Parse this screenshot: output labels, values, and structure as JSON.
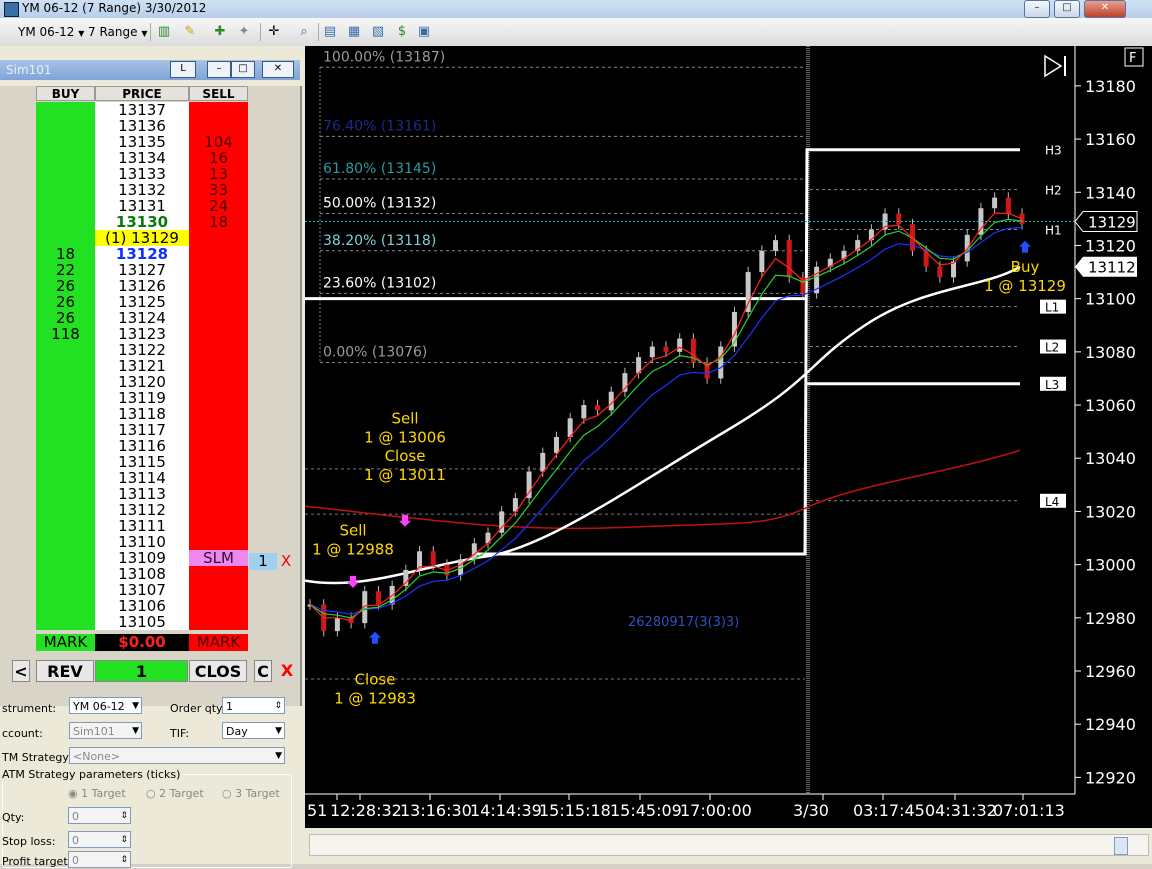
{
  "window": {
    "title": "YM 06-12 (7 Range)  3/30/2012",
    "min": "–",
    "max": "□",
    "close": "✕"
  },
  "toolbar": {
    "instrument": "YM 06-12",
    "period": "7 Range"
  },
  "dom": {
    "account": "Sim101",
    "btn_l": "L",
    "headers": {
      "buy": "BUY",
      "price": "PRICE",
      "sell": "SELL"
    },
    "rows": [
      {
        "price": "13137",
        "buy": "",
        "sell": ""
      },
      {
        "price": "13136",
        "buy": "",
        "sell": ""
      },
      {
        "price": "13135",
        "buy": "",
        "sell": "104"
      },
      {
        "price": "13134",
        "buy": "",
        "sell": "16"
      },
      {
        "price": "13133",
        "buy": "",
        "sell": "13"
      },
      {
        "price": "13132",
        "buy": "",
        "sell": "33"
      },
      {
        "price": "13131",
        "buy": "",
        "sell": "24"
      },
      {
        "price": "13130",
        "buy": "",
        "sell": "18"
      },
      {
        "price": "(1) 13129",
        "buy": "",
        "sell": ""
      },
      {
        "price": "13128",
        "buy": "18",
        "sell": ""
      },
      {
        "price": "13127",
        "buy": "22",
        "sell": ""
      },
      {
        "price": "13126",
        "buy": "26",
        "sell": ""
      },
      {
        "price": "13125",
        "buy": "26",
        "sell": ""
      },
      {
        "price": "13124",
        "buy": "26",
        "sell": ""
      },
      {
        "price": "13123",
        "buy": "118",
        "sell": ""
      },
      {
        "price": "13122",
        "buy": "",
        "sell": ""
      },
      {
        "price": "13121",
        "buy": "",
        "sell": ""
      },
      {
        "price": "13120",
        "buy": "",
        "sell": ""
      },
      {
        "price": "13119",
        "buy": "",
        "sell": ""
      },
      {
        "price": "13118",
        "buy": "",
        "sell": ""
      },
      {
        "price": "13117",
        "buy": "",
        "sell": ""
      },
      {
        "price": "13116",
        "buy": "",
        "sell": ""
      },
      {
        "price": "13115",
        "buy": "",
        "sell": ""
      },
      {
        "price": "13114",
        "buy": "",
        "sell": ""
      },
      {
        "price": "13113",
        "buy": "",
        "sell": ""
      },
      {
        "price": "13112",
        "buy": "",
        "sell": ""
      },
      {
        "price": "13111",
        "buy": "",
        "sell": ""
      },
      {
        "price": "13110",
        "buy": "",
        "sell": ""
      },
      {
        "price": "13109",
        "buy": "",
        "sell": "SLM"
      },
      {
        "price": "13108",
        "buy": "",
        "sell": ""
      },
      {
        "price": "13107",
        "buy": "",
        "sell": ""
      },
      {
        "price": "13106",
        "buy": "",
        "sell": ""
      },
      {
        "price": "13105",
        "buy": "",
        "sell": ""
      }
    ],
    "slm_qty": "1",
    "mark_left": "MARK",
    "pnl": "$0.00",
    "mark_right": "MARK",
    "controls": {
      "left": "<",
      "rev": "REV",
      "qty": "1",
      "clos": "CLOS",
      "c": "C",
      "x": "X"
    },
    "x_mark": "X"
  },
  "form": {
    "instrument_label": "strument:",
    "instrument_value": "YM 06-12",
    "order_qty_label": "Order qty:",
    "order_qty_value": "1",
    "account_label": "ccount:",
    "account_value": "Sim101",
    "tif_label": "TIF:",
    "tif_value": "Day",
    "atm_label": "TM Strategy:",
    "atm_value": "<None>",
    "atm_params_label": "ATM Strategy parameters (ticks)",
    "targets": [
      "1 Target",
      "2 Target",
      "3 Target"
    ],
    "qty_label": "Qty:",
    "qty_value": "0",
    "stop_label": "Stop loss:",
    "stop_value": "0",
    "profit_label": "Profit target:",
    "profit_value": "0"
  },
  "chart_data": {
    "type": "candlestick",
    "y_ticks": [
      13180,
      13160,
      13140,
      13120,
      13100,
      13080,
      13060,
      13040,
      13020,
      13000,
      12980,
      12960,
      12940,
      12920
    ],
    "ylim": [
      12913,
      13195
    ],
    "x_labels": [
      "51",
      "12:28:32",
      "13:16:30",
      "14:14:39",
      "15:15:18",
      "15:45:09",
      "17:00:00",
      "3/30",
      "03:17:45",
      "04:31:32",
      "07:01:13"
    ],
    "last_price_label": "13129",
    "marker_price_label": "13112",
    "fib_levels": [
      {
        "label": "100.00% (13187)",
        "price": 13187,
        "color": "#9a9a9a"
      },
      {
        "label": "76.40% (13161)",
        "price": 13161,
        "color": "#1c2a8a"
      },
      {
        "label": "61.80% (13145)",
        "price": 13145,
        "color": "#2a9a9a"
      },
      {
        "label": "50.00% (13132)",
        "price": 13132,
        "color": "#ffffff"
      },
      {
        "label": "38.20% (13118)",
        "price": 13118,
        "color": "#7fd0d0"
      },
      {
        "label": "23.60% (13102)",
        "price": 13102,
        "color": "#ffffff"
      },
      {
        "label": "0.00% (13076)",
        "price": 13076,
        "color": "#9a9a9a"
      }
    ],
    "pivots": [
      {
        "label": "H3",
        "price": 13156
      },
      {
        "label": "H2",
        "price": 13141
      },
      {
        "label": "H1",
        "price": 13126
      },
      {
        "label": "L1",
        "price": 13097
      },
      {
        "label": "L2",
        "price": 13082
      },
      {
        "label": "L3",
        "price": 13068
      },
      {
        "label": "L4",
        "price": 13024
      }
    ],
    "trades": [
      {
        "side": "Sell",
        "text": "1 @ 12988"
      },
      {
        "side": "Close",
        "text": "1 @ 12983"
      },
      {
        "side": "Sell",
        "text": "1 @ 13006"
      },
      {
        "side": "Close",
        "text": "1 @ 13011"
      },
      {
        "side": "Buy",
        "text": "1 @ 13129"
      }
    ],
    "center_text": "26280917(3(3)3)",
    "f_box": "F",
    "colors": {
      "up": "#c8c8c8",
      "down": "#d01818",
      "fast_ema": "#ff2020",
      "mid_ema": "#2ad22a",
      "slow_ema": "#2030ff",
      "ma": "#ffffff",
      "ma_long": "#c01010",
      "cursor": "#00c8c8",
      "trade_text": "#ffd700"
    }
  }
}
